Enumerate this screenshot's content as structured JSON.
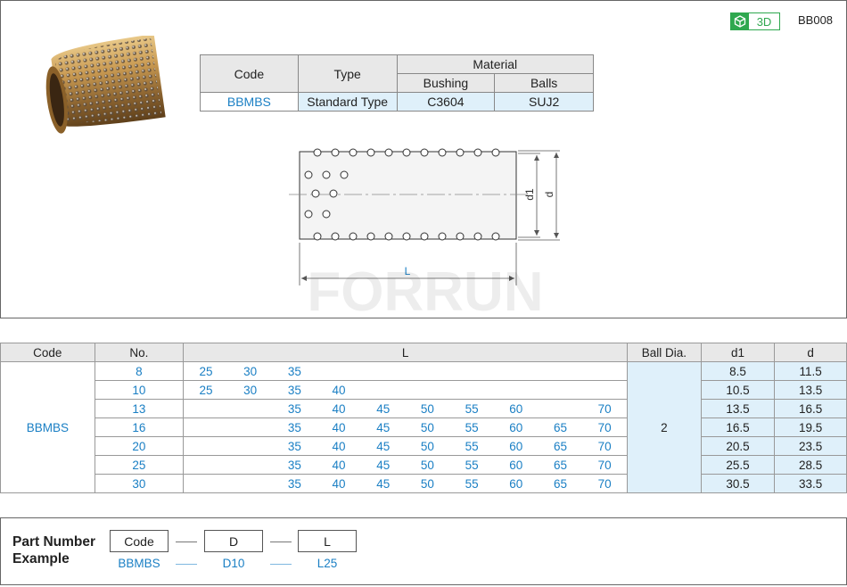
{
  "header": {
    "badge_3d": "3D",
    "product_code": "BB008"
  },
  "material_table": {
    "code_header": "Code",
    "type_header": "Type",
    "material_header": "Material",
    "bushing_header": "Bushing",
    "balls_header": "Balls",
    "row": {
      "code": "BBMBS",
      "type": "Standard Type",
      "bushing": "C3604",
      "balls": "SUJ2"
    }
  },
  "drawing": {
    "label_L": "L",
    "label_d1": "d1",
    "label_d": "d",
    "watermark": "FORRUN"
  },
  "dims_table": {
    "headers": {
      "code": "Code",
      "no": "No.",
      "L": "L",
      "ball_dia": "Ball Dia.",
      "d1": "d1",
      "d": "d"
    },
    "code": "BBMBS",
    "ball_dia": "2",
    "rows": [
      {
        "no": "8",
        "L": [
          "25",
          "30",
          "35",
          "",
          "",
          "",
          "",
          "",
          ""
        ],
        "d1": "8.5",
        "d": "11.5"
      },
      {
        "no": "10",
        "L": [
          "25",
          "30",
          "35",
          "40",
          "",
          "",
          "",
          "",
          ""
        ],
        "d1": "10.5",
        "d": "13.5"
      },
      {
        "no": "13",
        "L": [
          "",
          "",
          "35",
          "40",
          "45",
          "50",
          "55",
          "60",
          "",
          "70"
        ],
        "d1": "13.5",
        "d": "16.5"
      },
      {
        "no": "16",
        "L": [
          "",
          "",
          "35",
          "40",
          "45",
          "50",
          "55",
          "60",
          "65",
          "70"
        ],
        "d1": "16.5",
        "d": "19.5"
      },
      {
        "no": "20",
        "L": [
          "",
          "",
          "35",
          "40",
          "45",
          "50",
          "55",
          "60",
          "65",
          "70"
        ],
        "d1": "20.5",
        "d": "23.5"
      },
      {
        "no": "25",
        "L": [
          "",
          "",
          "35",
          "40",
          "45",
          "50",
          "55",
          "60",
          "65",
          "70"
        ],
        "d1": "25.5",
        "d": "28.5"
      },
      {
        "no": "30",
        "L": [
          "",
          "",
          "35",
          "40",
          "45",
          "50",
          "55",
          "60",
          "65",
          "70"
        ],
        "d1": "30.5",
        "d": "33.5"
      }
    ]
  },
  "part_number": {
    "title_line1": "Part Number",
    "title_line2": "Example",
    "boxes": [
      "Code",
      "D",
      "L"
    ],
    "examples": [
      "BBMBS",
      "D10",
      "L25"
    ]
  }
}
